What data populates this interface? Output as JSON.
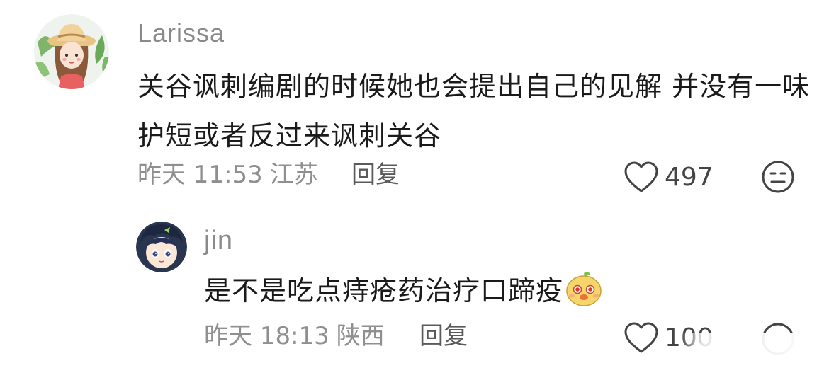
{
  "comments": [
    {
      "username": "Larissa",
      "text": "关谷讽刺编剧的时候她也会提出自己的见解 并没有一味护短或者反过来讽刺关谷",
      "time": "昨天 11:53",
      "location": "江苏",
      "reply_label": "回复",
      "likes": "497",
      "avatar_icon": "girl-straw-hat-avatar",
      "dislike_icon": "meh-face-icon",
      "like_icon": "heart-outline-icon"
    },
    {
      "username": "jin",
      "text": "是不是吃点痔疮药治疗口蹄疫",
      "time": "昨天 18:13",
      "location": "陕西",
      "reply_label": "回复",
      "likes": "100",
      "avatar_icon": "anime-boy-avatar",
      "emoji_icon": "cute-face-emoji",
      "dislike_icon": "meh-face-icon",
      "like_icon": "heart-outline-icon"
    }
  ],
  "colors": {
    "username": "#8a8a8a",
    "text": "#1a1a1a",
    "meta": "#8f8f8f",
    "reply": "#5a5a5a",
    "icon": "#444444"
  }
}
